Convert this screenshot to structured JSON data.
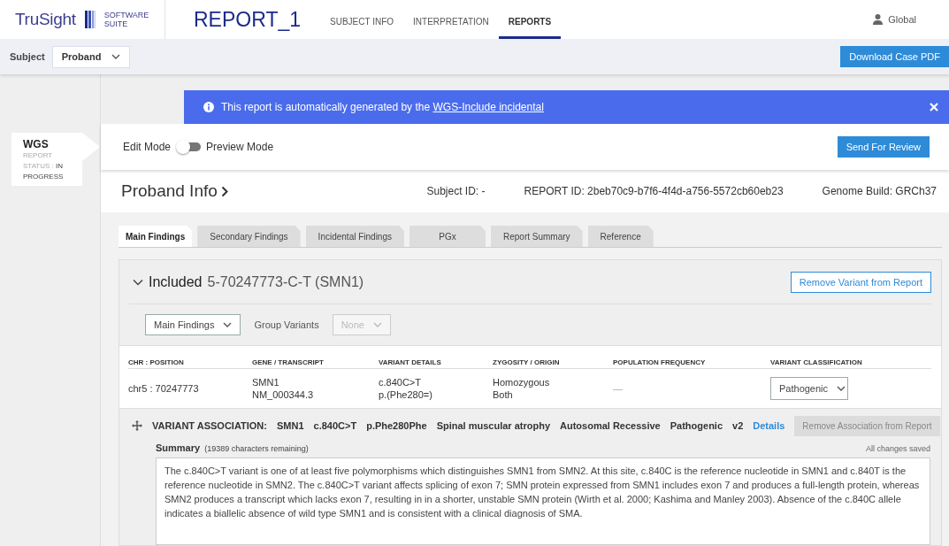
{
  "header": {
    "logo": "TruSight",
    "logo_sub": "SOFTWARE SUITE",
    "title": "REPORT_1",
    "nav": [
      {
        "label": "SUBJECT INFO",
        "selected": false
      },
      {
        "label": "INTERPRETATION",
        "selected": false
      },
      {
        "label": "REPORTS",
        "selected": true
      }
    ],
    "user": "Global"
  },
  "subject_bar": {
    "label": "Subject",
    "value": "Proband",
    "button": "Download Case PDF"
  },
  "side_card": {
    "title": "WGS",
    "status": "REPORT STATUS : **IN PROGRESS**"
  },
  "banner": {
    "text": "This report is automatically generated by the",
    "link": "WGS-Include incidental"
  },
  "mode": {
    "left": "Edit Mode",
    "right": "Preview Mode",
    "on": false
  },
  "send_button": "Send For Review",
  "info": {
    "title": "Proband Info",
    "subject_id": "Subject ID: -",
    "report_id": "REPORT ID: 2beb70c9-b7f6-4f4d-a756-5572cb60eb23",
    "genome_build": "Genome Build: GRCh37"
  },
  "tabs": [
    {
      "label": "Main Findings",
      "selected": true
    },
    {
      "label": "Secondary Findings",
      "selected": false
    },
    {
      "label": "Incidental Findings",
      "selected": false
    },
    {
      "label": "PGx",
      "selected": false
    },
    {
      "label": "Report Summary",
      "selected": false
    },
    {
      "label": "Reference",
      "selected": false
    }
  ],
  "variant": {
    "expanded": true,
    "status": "Included",
    "name": "5-70247773-C-T (SMN1)",
    "remove_button": "Remove Variant from Report",
    "findings_select": "Main Findings",
    "group_label": "Group Variants",
    "group_select": {
      "value": "None",
      "disabled": true
    },
    "table": {
      "columns": [
        "CHR : POSITION",
        "GENE / TRANSCRIPT",
        "VARIANT DETAILS",
        "ZYGOSITY / ORIGIN",
        "POPULATION FREQUENCY",
        "VARIANT CLASSIFICATION"
      ],
      "rows": [
        {
          "position": [
            "chr5 : 70247773"
          ],
          "gene": [
            "SMN1",
            "NM_000344.3"
          ],
          "details": [
            "c.840C>T",
            "p.(Phe280=)"
          ],
          "zygosity": [
            "Homozygous",
            "Both"
          ],
          "frequency": [
            "—"
          ],
          "classification": "Pathogenic"
        }
      ]
    },
    "association": {
      "label": "VARIANT ASSOCIATION:",
      "items": [
        "SMN1",
        "c.840C>T",
        "p.Phe280Phe",
        "Spinal muscular atrophy",
        "Autosomal Recessive",
        "Pathogenic",
        "v2"
      ],
      "link": "Details",
      "button": {
        "label": "Remove Association from Report",
        "disabled": true
      }
    },
    "summary": {
      "label": "Summary",
      "remaining": "(19389 characters remaining)",
      "saved": "All changes saved",
      "text": "The c.840C>T variant is one of at least five polymorphisms which distinguishes SMN1 from SMN2. At this site, c.840C is the reference nucleotide in SMN1 and c.840T is the reference nucleotide in SMN2. The c.840C>T variant affects splicing of exon 7; SMN protein expressed from SMN1 includes exon 7 and produces a full-length protein, whereas SMN2 produces a transcript which lacks exon 7, resulting in in a shorter, unstable SMN protein (Wirth et al. 2000; Kashima and Manley 2003).  Absence of the c.840C allele indicates a biallelic absence of wild type SMN1 and is consistent with a clinical diagnosis of SMA."
    }
  }
}
